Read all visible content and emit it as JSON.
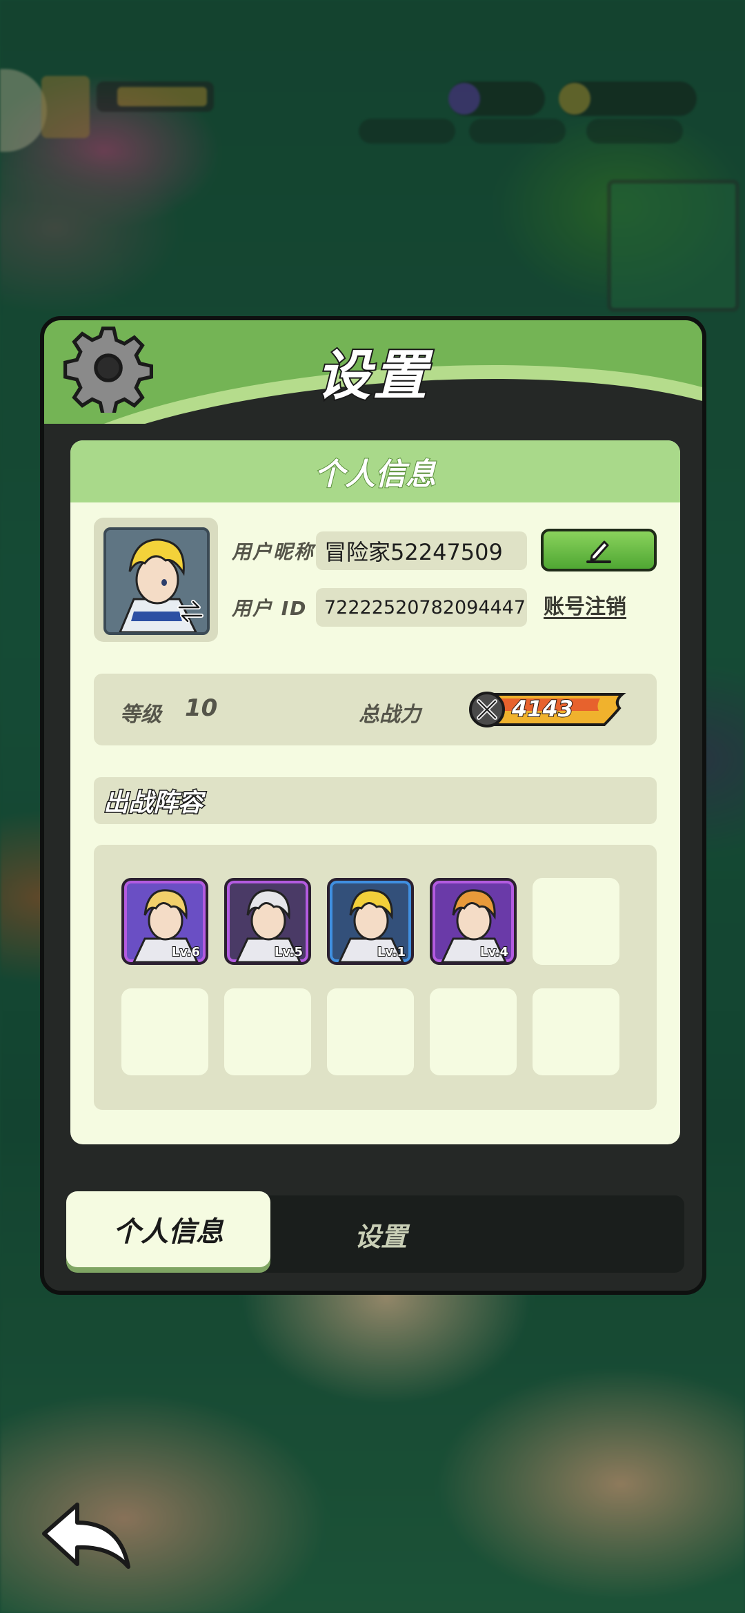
{
  "panel": {
    "title": "设置"
  },
  "profile": {
    "section_title": "个人信息",
    "nickname_label": "用户昵称",
    "nickname": "冒险家52247509",
    "id_label": "用户 ID",
    "user_id": "72222520782094447",
    "cancel_account_label": "账号注销"
  },
  "stats": {
    "level_label": "等级",
    "level": "10",
    "power_label": "总战力",
    "power": "4143"
  },
  "lineup": {
    "title": "出战阵容",
    "heroes": [
      {
        "level": "Lv.6",
        "frame_color": "#b35be0",
        "bg": "#6a4fc4",
        "hair": "#f2d06b"
      },
      {
        "level": "Lv.5",
        "frame_color": "#b35be0",
        "bg": "#4a3a66",
        "hair": "#e6e6ea"
      },
      {
        "level": "Lv.1",
        "frame_color": "#3f8fe0",
        "bg": "#33507a",
        "hair": "#f2cf3a"
      },
      {
        "level": "Lv.4",
        "frame_color": "#b35be0",
        "bg": "#6a3aa8",
        "hair": "#e89a3a"
      }
    ],
    "empty_slots": 6
  },
  "tabs": {
    "active": "个人信息",
    "inactive": "设置"
  },
  "colors": {
    "accent_green": "#74b455",
    "card_bg": "#f5fbe1",
    "power_bar": "#f0b22d"
  }
}
